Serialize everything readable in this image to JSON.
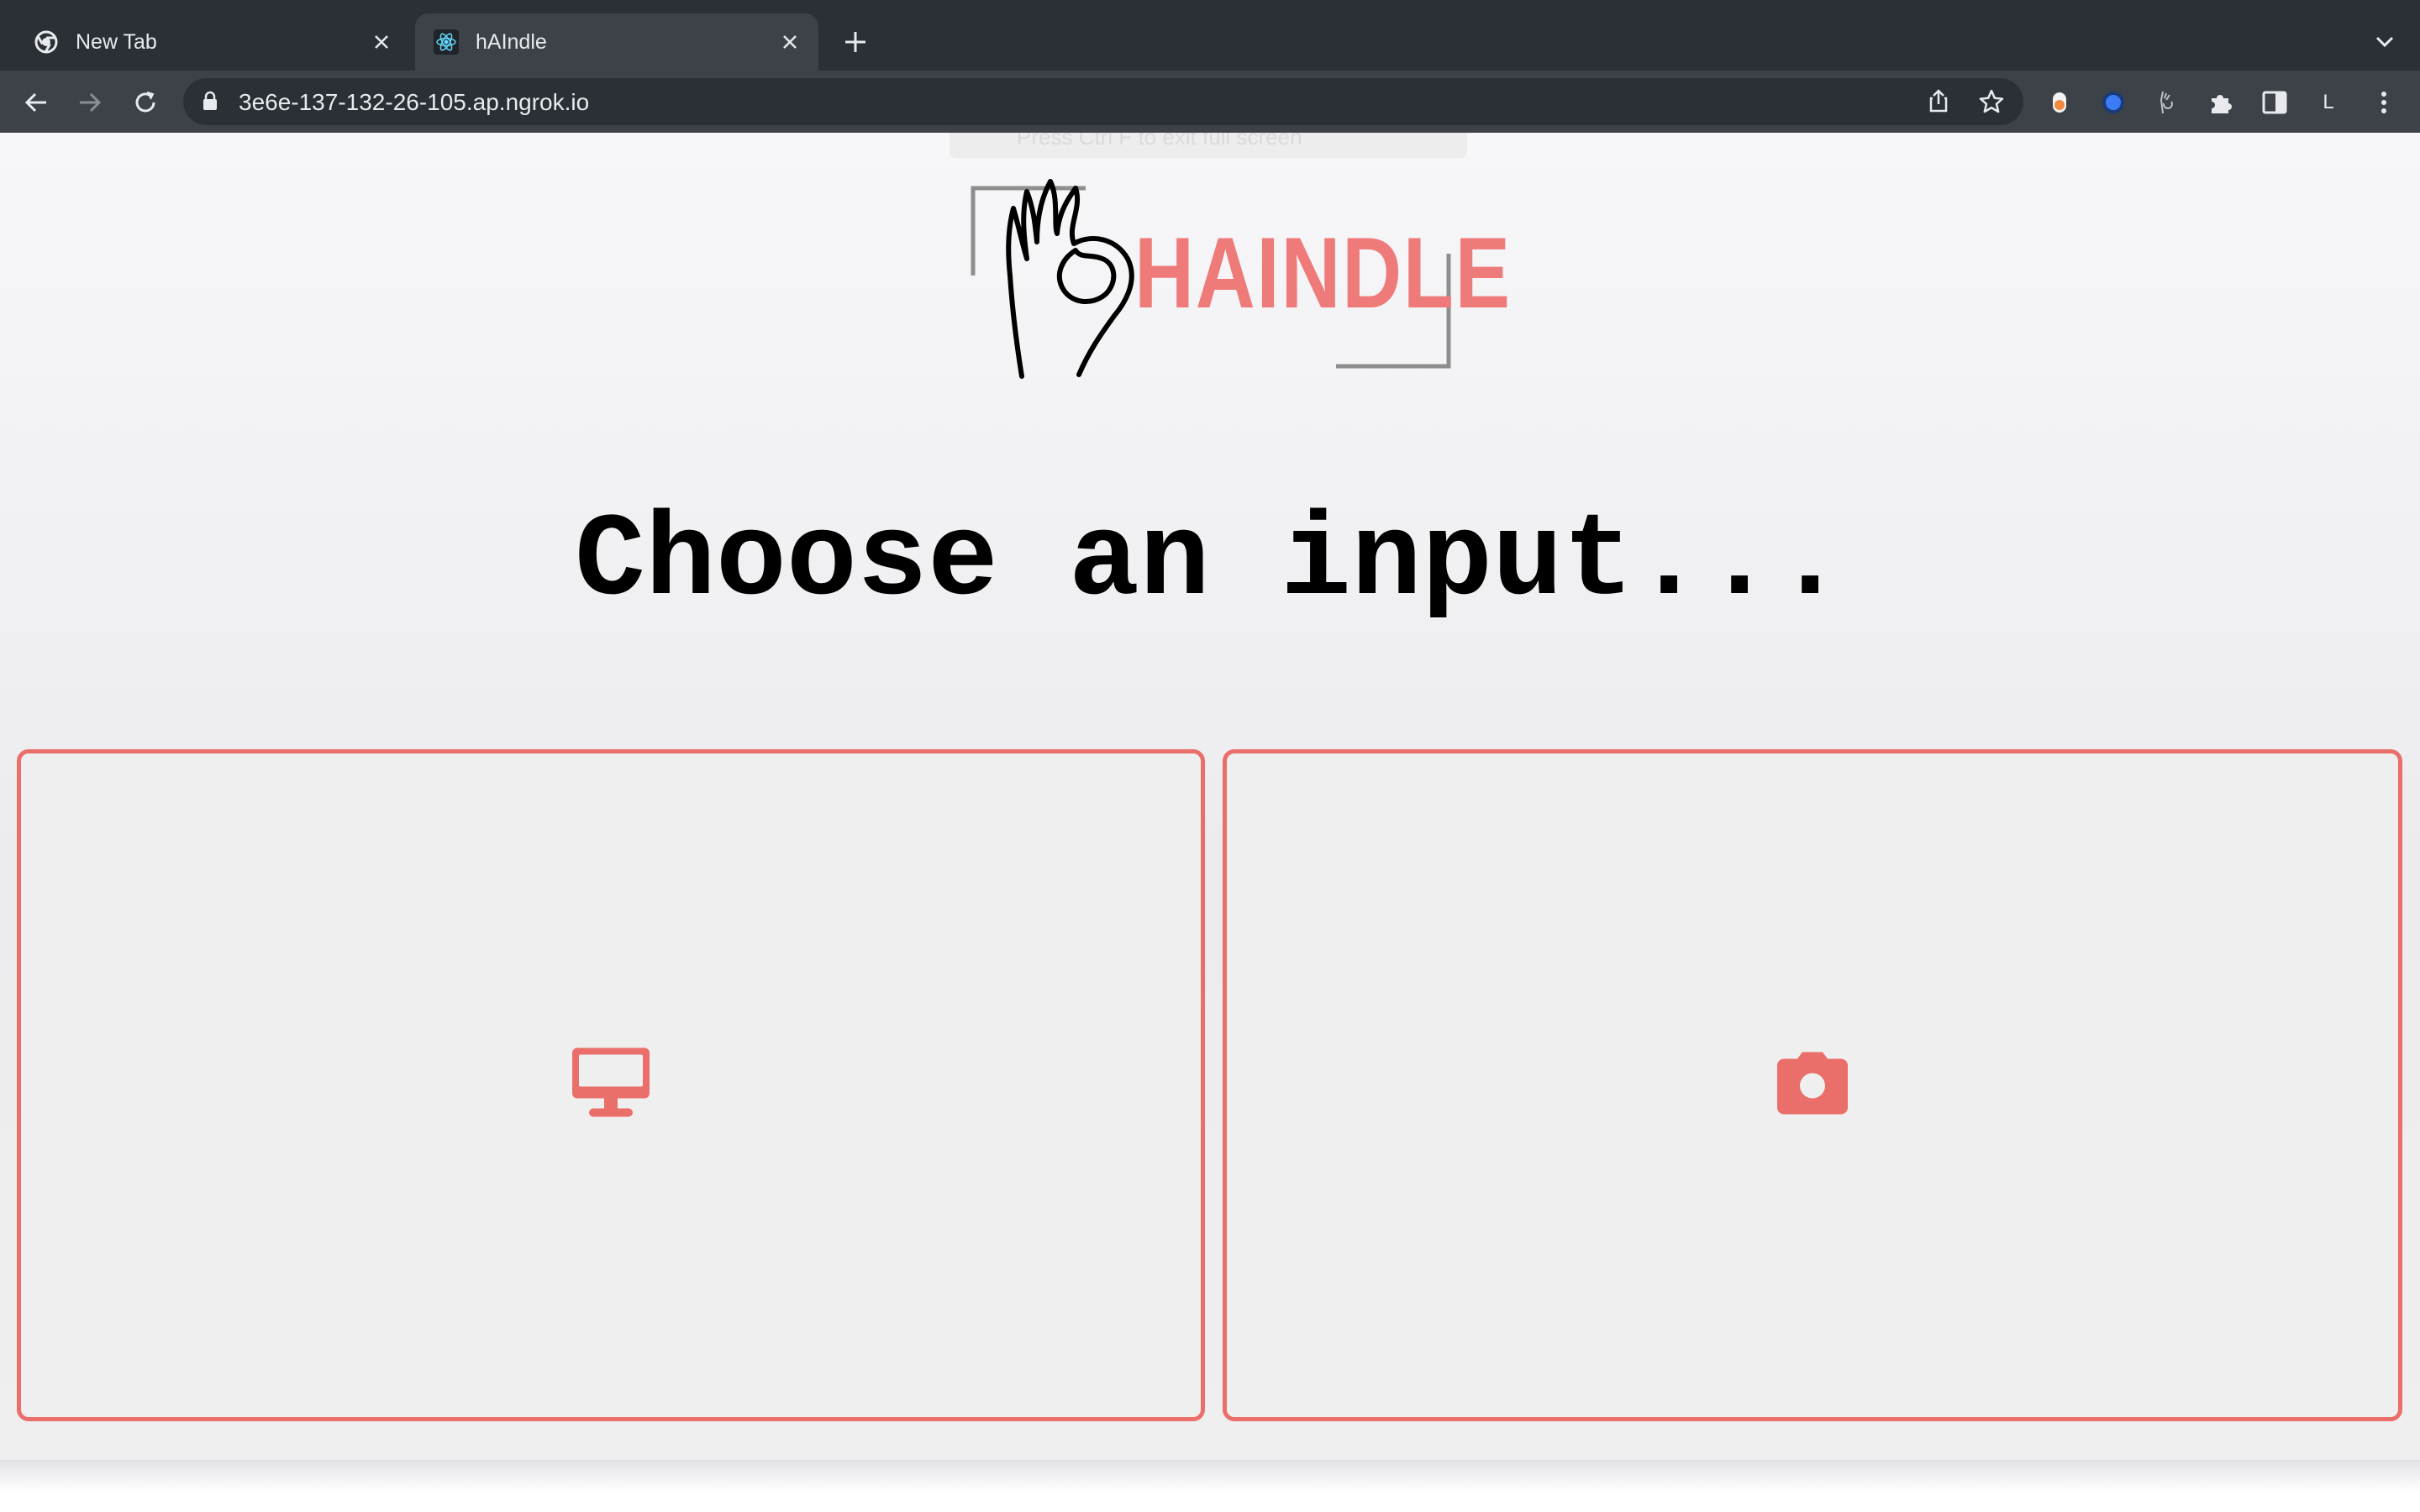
{
  "browser": {
    "tabs": [
      {
        "title": "New Tab",
        "active": false,
        "favicon": "chrome-icon"
      },
      {
        "title": "hAIndle",
        "active": true,
        "favicon": "react-icon"
      }
    ],
    "url": "3e6e-137-132-26-105.ap.ngrok.io",
    "profile_initial": "L"
  },
  "page": {
    "fullscreen_hint": "Press  Ctrl F  to exit full screen",
    "logo_text": "HAINDLE",
    "heading": "Choose an input...",
    "options": [
      {
        "icon": "desktop-icon",
        "color": "#ea6e6a"
      },
      {
        "icon": "camera-icon",
        "color": "#ea6e6a"
      }
    ]
  },
  "colors": {
    "accent": "#ea6e6a",
    "tabstrip": "#2b3036",
    "toolbar": "#3c4248"
  }
}
